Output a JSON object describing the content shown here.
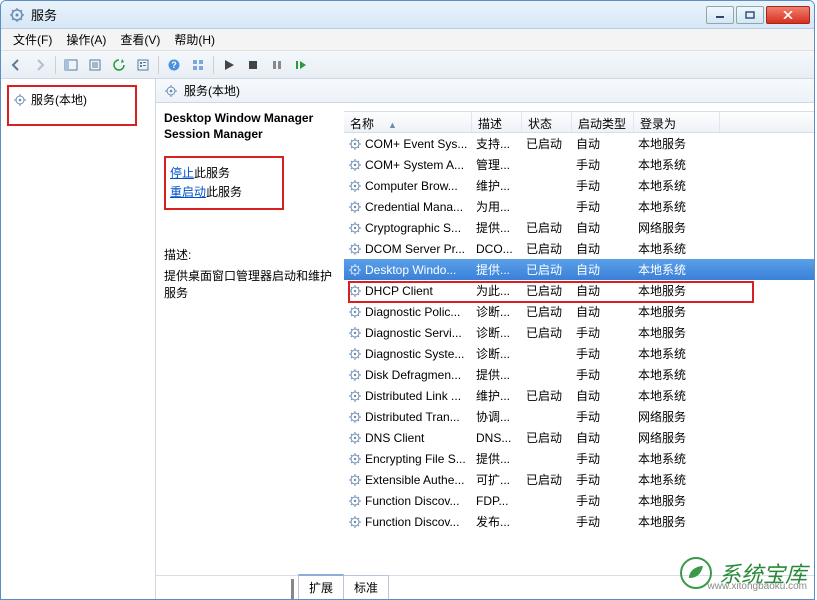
{
  "window": {
    "title": "服务"
  },
  "menu": {
    "file": "文件(F)",
    "action": "操作(A)",
    "view": "查看(V)",
    "help": "帮助(H)"
  },
  "tree": {
    "root": "服务(本地)"
  },
  "pane": {
    "header": "服务(本地)"
  },
  "detail": {
    "selected_name": "Desktop Window Manager Session Manager",
    "action_stop_link": "停止",
    "action_stop_suffix": "此服务",
    "action_restart_link": "重启动",
    "action_restart_suffix": "此服务",
    "desc_label": "描述:",
    "desc_text": "提供桌面窗口管理器启动和维护服务"
  },
  "columns": {
    "name": "名称",
    "desc": "描述",
    "status": "状态",
    "start": "启动类型",
    "logon": "登录为"
  },
  "rows": [
    {
      "name": "COM+ Event Sys...",
      "desc": "支持...",
      "status": "已启动",
      "start": "自动",
      "logon": "本地服务"
    },
    {
      "name": "COM+ System A...",
      "desc": "管理...",
      "status": "",
      "start": "手动",
      "logon": "本地系统"
    },
    {
      "name": "Computer Brow...",
      "desc": "维护...",
      "status": "",
      "start": "手动",
      "logon": "本地系统"
    },
    {
      "name": "Credential Mana...",
      "desc": "为用...",
      "status": "",
      "start": "手动",
      "logon": "本地系统"
    },
    {
      "name": "Cryptographic S...",
      "desc": "提供...",
      "status": "已启动",
      "start": "自动",
      "logon": "网络服务"
    },
    {
      "name": "DCOM Server Pr...",
      "desc": "DCO...",
      "status": "已启动",
      "start": "自动",
      "logon": "本地系统"
    },
    {
      "name": "Desktop Windo...",
      "desc": "提供...",
      "status": "已启动",
      "start": "自动",
      "logon": "本地系统",
      "selected": true
    },
    {
      "name": "DHCP Client",
      "desc": "为此...",
      "status": "已启动",
      "start": "自动",
      "logon": "本地服务"
    },
    {
      "name": "Diagnostic Polic...",
      "desc": "诊断...",
      "status": "已启动",
      "start": "自动",
      "logon": "本地服务"
    },
    {
      "name": "Diagnostic Servi...",
      "desc": "诊断...",
      "status": "已启动",
      "start": "手动",
      "logon": "本地服务"
    },
    {
      "name": "Diagnostic Syste...",
      "desc": "诊断...",
      "status": "",
      "start": "手动",
      "logon": "本地系统"
    },
    {
      "name": "Disk Defragmen...",
      "desc": "提供...",
      "status": "",
      "start": "手动",
      "logon": "本地系统"
    },
    {
      "name": "Distributed Link ...",
      "desc": "维护...",
      "status": "已启动",
      "start": "自动",
      "logon": "本地系统"
    },
    {
      "name": "Distributed Tran...",
      "desc": "协调...",
      "status": "",
      "start": "手动",
      "logon": "网络服务"
    },
    {
      "name": "DNS Client",
      "desc": "DNS...",
      "status": "已启动",
      "start": "自动",
      "logon": "网络服务"
    },
    {
      "name": "Encrypting File S...",
      "desc": "提供...",
      "status": "",
      "start": "手动",
      "logon": "本地系统"
    },
    {
      "name": "Extensible Authe...",
      "desc": "可扩...",
      "status": "已启动",
      "start": "手动",
      "logon": "本地系统"
    },
    {
      "name": "Function Discov...",
      "desc": "FDP...",
      "status": "",
      "start": "手动",
      "logon": "本地服务"
    },
    {
      "name": "Function Discov...",
      "desc": "发布...",
      "status": "",
      "start": "手动",
      "logon": "本地服务"
    }
  ],
  "tabs": {
    "extended": "扩展",
    "standard": "标准"
  },
  "watermark": {
    "text": "系统宝库",
    "url": "www.xitongbaoku.com"
  }
}
